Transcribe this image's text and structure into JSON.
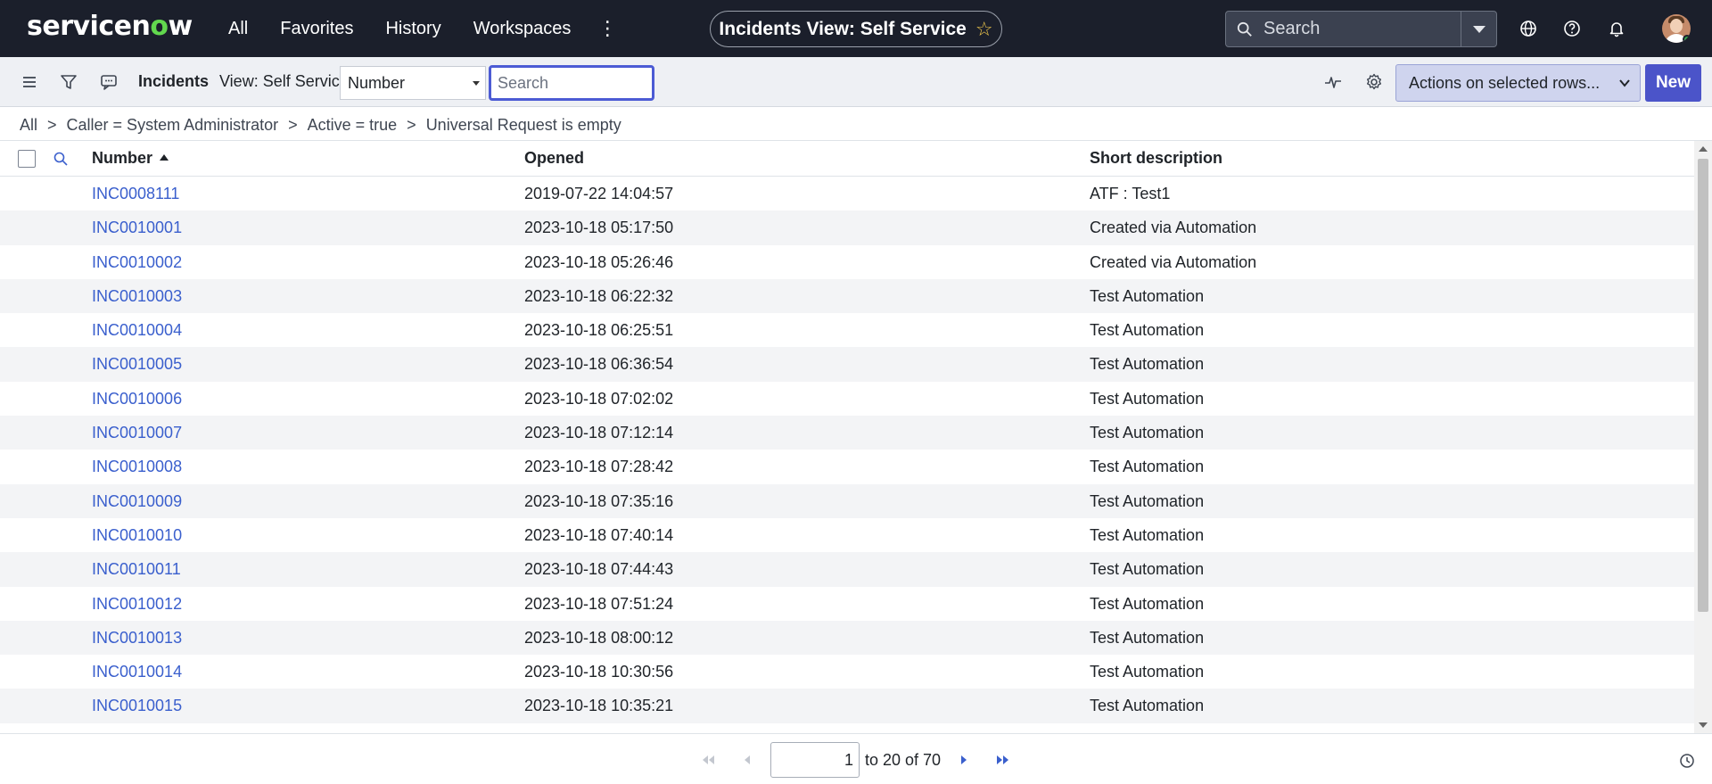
{
  "topnav": {
    "logo_pre": "servicen",
    "logo_o": "o",
    "logo_post": "w",
    "links": [
      "All",
      "Favorites",
      "History",
      "Workspaces"
    ],
    "more": "⋮",
    "page_title": "Incidents View: Self Service",
    "search_placeholder": "Search"
  },
  "toolbar": {
    "list_title": "Incidents",
    "view_label": "View: Self Service",
    "field_select_value": "Number",
    "search_placeholder": "Search",
    "actions_label": "Actions on selected rows...",
    "new_label": "New"
  },
  "breadcrumb": [
    "All",
    "Caller = System Administrator",
    "Active = true",
    "Universal Request is empty"
  ],
  "breadcrumb_sep": ">",
  "table": {
    "columns": [
      "Number",
      "Opened",
      "Short description"
    ],
    "rows": [
      {
        "number": "INC0008111",
        "opened": "2019-07-22 14:04:57",
        "desc": "ATF : Test1"
      },
      {
        "number": "INC0010001",
        "opened": "2023-10-18 05:17:50",
        "desc": "Created via Automation"
      },
      {
        "number": "INC0010002",
        "opened": "2023-10-18 05:26:46",
        "desc": "Created via Automation"
      },
      {
        "number": "INC0010003",
        "opened": "2023-10-18 06:22:32",
        "desc": "Test Automation"
      },
      {
        "number": "INC0010004",
        "opened": "2023-10-18 06:25:51",
        "desc": "Test Automation"
      },
      {
        "number": "INC0010005",
        "opened": "2023-10-18 06:36:54",
        "desc": "Test Automation"
      },
      {
        "number": "INC0010006",
        "opened": "2023-10-18 07:02:02",
        "desc": "Test Automation"
      },
      {
        "number": "INC0010007",
        "opened": "2023-10-18 07:12:14",
        "desc": "Test Automation"
      },
      {
        "number": "INC0010008",
        "opened": "2023-10-18 07:28:42",
        "desc": "Test Automation"
      },
      {
        "number": "INC0010009",
        "opened": "2023-10-18 07:35:16",
        "desc": "Test Automation"
      },
      {
        "number": "INC0010010",
        "opened": "2023-10-18 07:40:14",
        "desc": "Test Automation"
      },
      {
        "number": "INC0010011",
        "opened": "2023-10-18 07:44:43",
        "desc": "Test Automation"
      },
      {
        "number": "INC0010012",
        "opened": "2023-10-18 07:51:24",
        "desc": "Test Automation"
      },
      {
        "number": "INC0010013",
        "opened": "2023-10-18 08:00:12",
        "desc": "Test Automation"
      },
      {
        "number": "INC0010014",
        "opened": "2023-10-18 10:30:56",
        "desc": "Test Automation"
      },
      {
        "number": "INC0010015",
        "opened": "2023-10-18 10:35:21",
        "desc": "Test Automation"
      }
    ]
  },
  "pagination": {
    "page_value": "1",
    "range_text": "to 20 of 70"
  },
  "icons": {
    "topnav": [
      "search-icon",
      "globe-icon",
      "help-icon",
      "bell-icon",
      "star-icon"
    ],
    "toolbar": [
      "menu-icon",
      "filter-icon",
      "chat-icon",
      "activity-icon",
      "gear-icon",
      "chevron-down-icon"
    ],
    "pagination": [
      "first-page-icon",
      "prev-page-icon",
      "next-page-icon",
      "last-page-icon",
      "clock-icon"
    ]
  },
  "colors": {
    "topnav_bg": "#1b1f2b",
    "accent": "#4b54c9",
    "link": "#3a5fcd",
    "logo_green": "#62d84e"
  }
}
